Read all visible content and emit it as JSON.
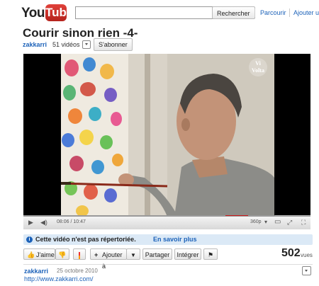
{
  "header": {
    "logo_you": "You",
    "logo_tube": "Tube",
    "search_placeholder": "",
    "search_button": "Rechercher",
    "nav_browse": "Parcourir",
    "nav_upload": "Ajouter u"
  },
  "video": {
    "title": "Courir sinon rien -4-",
    "channel": "zakkarri",
    "videos_count": "51 vidéos",
    "subscribe": "S'abonner",
    "watermark": "Vi\nVolta"
  },
  "player": {
    "current_time": "08:06",
    "duration": "10:47",
    "time_sep": " / ",
    "quality": "360p",
    "progress_fraction": 0.75,
    "loaded_fraction": 0.88
  },
  "notice": {
    "text": "Cette vidéo n'est pas répertoriée.",
    "link": "En savoir plus"
  },
  "actions": {
    "like": "J'aime",
    "add_to": "Ajouter à",
    "share": "Partager",
    "embed": "Intégrer",
    "views_count": "502",
    "views_label": "vues"
  },
  "description": {
    "author": "zakkarri",
    "date": "25 octobre 2010",
    "link": "http://www.zakkarri.com/"
  },
  "colors": {
    "brand_red": "#cc1a1a",
    "link_blue": "#1c62b9",
    "notice_bg": "#dbe9f6"
  }
}
